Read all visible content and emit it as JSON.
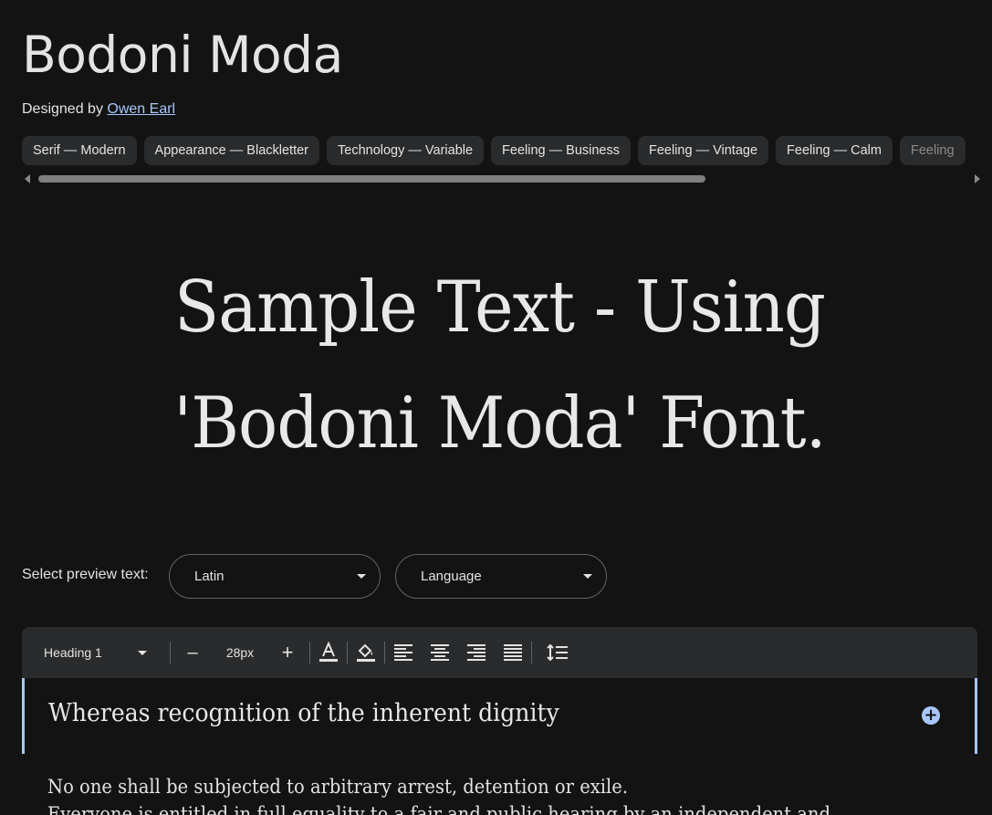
{
  "family": {
    "name": "Bodoni Moda",
    "designed_by_label": "Designed by",
    "designer": "Owen Earl"
  },
  "tags": [
    "Serif — Modern",
    "Appearance — Blackletter",
    "Technology — Variable",
    "Feeling — Business",
    "Feeling — Vintage",
    "Feeling — Calm",
    "Feeling"
  ],
  "sample_text": "Sample Text - Using 'Bodoni Moda' Font.",
  "preview": {
    "label": "Select preview text:",
    "script_select": "Latin",
    "language_select": "Language"
  },
  "toolbar": {
    "style_select": "Heading 1",
    "decrease": "–",
    "size": "28px",
    "increase": "+"
  },
  "editor": {
    "heading": "Whereas recognition of the inherent dignity",
    "add_button": "+",
    "lines": [
      "No one shall be subjected to arbitrary arrest, detention or exile.",
      "Everyone is entitled in full equality to a fair and public hearing by an independent and"
    ]
  },
  "colors": {
    "background": "#131313",
    "accent": "#a8c7fa",
    "chip": "#2a2b2c"
  }
}
